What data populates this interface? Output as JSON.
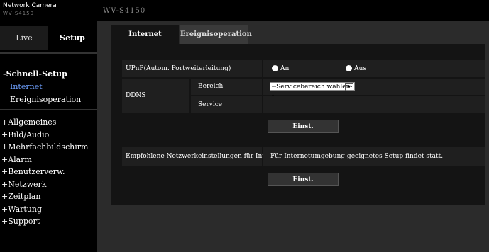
{
  "brand": {
    "title": "Network Camera",
    "subtitle": "WV-S4150"
  },
  "model": "WV-S4150",
  "mode": {
    "live": "Live",
    "setup": "Setup"
  },
  "sidebar": {
    "section": "-Schnell-Setup",
    "sub": [
      {
        "label": "Internet"
      },
      {
        "label": "Ereignisoperation"
      }
    ],
    "menu": [
      "+Allgemeines",
      "+Bild/Audio",
      "+Mehrfachbildschirm",
      "+Alarm",
      "+Benutzerverw.",
      "+Netzwerk",
      "+Zeitplan",
      "+Wartung",
      "+Support"
    ]
  },
  "tabs": {
    "internet": "Internet",
    "ereignis": "Ereignisoperation"
  },
  "form": {
    "upnp": {
      "label": "UPnP(Autom. Portweiterleitung)",
      "opt_on": "An",
      "opt_off": "Aus"
    },
    "ddns": {
      "label": "DDNS",
      "bereich_label": "Bereich",
      "bereich_value": "--Servicebereich wählen--",
      "service_label": "Service"
    },
    "set_button": "Einst.",
    "recommended": {
      "label": "Empfohlene Netzwerkeinstellungen für Internet",
      "desc": "Für Internetumgebung geeignetes Setup findet statt.",
      "button": "Einst."
    }
  }
}
